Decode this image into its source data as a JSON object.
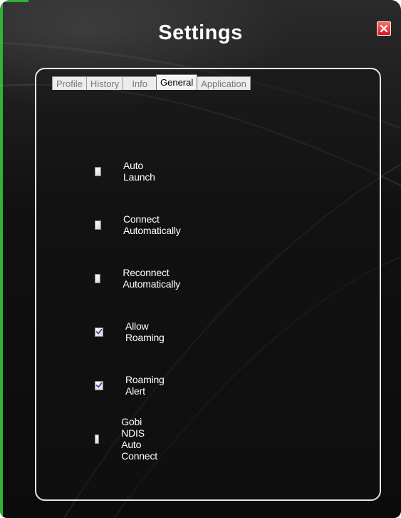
{
  "window": {
    "title": "Settings"
  },
  "tabs": [
    {
      "label": "Profile",
      "active": false
    },
    {
      "label": "History",
      "active": false
    },
    {
      "label": "Info",
      "active": false
    },
    {
      "label": "General",
      "active": true
    },
    {
      "label": "Application",
      "active": false
    }
  ],
  "options": [
    {
      "label": "Auto Launch",
      "checked": false
    },
    {
      "label": "Connect Automatically",
      "checked": false
    },
    {
      "label": "Reconnect Automatically",
      "checked": false
    },
    {
      "label": "Allow Roaming",
      "checked": true
    },
    {
      "label": "Roaming Alert",
      "checked": true
    },
    {
      "label": "Gobi NDIS Auto Connect",
      "checked": false
    }
  ],
  "colors": {
    "close_button": "#e02222",
    "accent_edge": "#2fb33a",
    "check_mark": "#3a4fb0"
  }
}
